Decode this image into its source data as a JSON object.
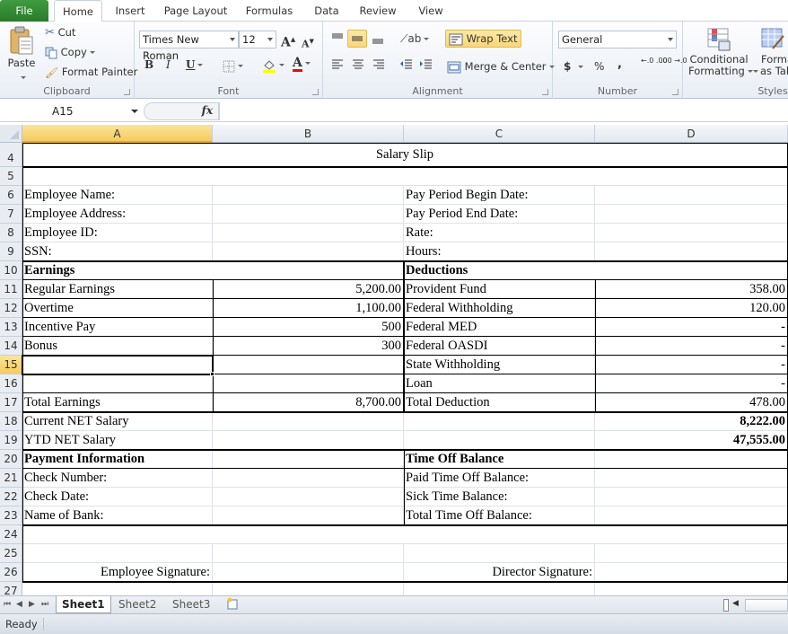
{
  "ribbon_tabs": [
    {
      "label": "File"
    },
    {
      "label": "Home"
    },
    {
      "label": "Insert"
    },
    {
      "label": "Page Layout"
    },
    {
      "label": "Formulas"
    },
    {
      "label": "Data"
    },
    {
      "label": "Review"
    },
    {
      "label": "View"
    }
  ],
  "active_tab": "Home",
  "clipboard": {
    "paste": "Paste",
    "cut": "Cut",
    "copy": "Copy",
    "format_painter": "Format Painter",
    "group_label": "Clipboard"
  },
  "font": {
    "name": "Times New Roman",
    "size": "12",
    "group_label": "Font",
    "bold": "B",
    "italic": "I",
    "underline": "U",
    "grow": "A",
    "shrink": "A",
    "font_color": "A",
    "fill_color_hex": "#ffff00",
    "font_color_hex": "#ff0000"
  },
  "alignment": {
    "wrap_text": "Wrap Text",
    "merge_center": "Merge & Center",
    "group_label": "Alignment"
  },
  "number": {
    "format": "General",
    "currency": "$",
    "percent": "%",
    "comma": ",",
    "inc_decimal": "←.0 .00",
    "dec_decimal": ".00 →.0",
    "group_label": "Number"
  },
  "styles": {
    "conditional_formatting_line1": "Conditional",
    "conditional_formatting_line2": "Formatting",
    "format_as_table_line1": "Format",
    "format_as_table_line2": "as Table",
    "group_label": "Styles"
  },
  "formula_bar": {
    "name_box": "A15",
    "fx": "fx",
    "content": ""
  },
  "columns": [
    "A",
    "B",
    "C",
    "D"
  ],
  "selected_column": "A",
  "selected_row": "15",
  "rows": [
    {
      "num": "4"
    },
    {
      "num": "5"
    },
    {
      "num": "6"
    },
    {
      "num": "7"
    },
    {
      "num": "8"
    },
    {
      "num": "9"
    },
    {
      "num": "10"
    },
    {
      "num": "11"
    },
    {
      "num": "12"
    },
    {
      "num": "13"
    },
    {
      "num": "14"
    },
    {
      "num": "15"
    },
    {
      "num": "16"
    },
    {
      "num": "17"
    },
    {
      "num": "18"
    },
    {
      "num": "19"
    },
    {
      "num": "20"
    },
    {
      "num": "21"
    },
    {
      "num": "22"
    },
    {
      "num": "23"
    },
    {
      "num": "24"
    },
    {
      "num": "25"
    },
    {
      "num": "26"
    },
    {
      "num": "27"
    }
  ],
  "sheet": {
    "title": "Salary Slip",
    "employee_info": [
      {
        "label": "Employee Name:",
        "right_label": "Pay Period Begin Date:"
      },
      {
        "label": "Employee Address:",
        "right_label": "Pay Period End Date:"
      },
      {
        "label": "Employee ID:",
        "right_label": "Rate:"
      },
      {
        "label": "SSN:",
        "right_label": "Hours:"
      }
    ],
    "earnings_header": "Earnings",
    "deductions_header": "Deductions",
    "earnings": [
      {
        "label": "Regular Earnings",
        "value": "5,200.00"
      },
      {
        "label": "Overtime",
        "value": "1,100.00"
      },
      {
        "label": "Incentive Pay",
        "value": "500"
      },
      {
        "label": "Bonus",
        "value": "300"
      },
      {
        "label": "",
        "value": ""
      },
      {
        "label": "",
        "value": ""
      }
    ],
    "deductions": [
      {
        "label": "Provident Fund",
        "value": "358.00"
      },
      {
        "label": "Federal Withholding",
        "value": "120.00"
      },
      {
        "label": "Federal MED",
        "value": "-"
      },
      {
        "label": "Federal OASDI",
        "value": "-"
      },
      {
        "label": "State Withholding",
        "value": "-"
      },
      {
        "label": "Loan",
        "value": "-"
      }
    ],
    "total_earnings_label": "Total Earnings",
    "total_earnings_value": "8,700.00",
    "total_deduction_label": "Total Deduction",
    "total_deduction_value": "478.00",
    "current_net_label": "Current NET Salary",
    "current_net_value": "8,222.00",
    "ytd_net_label": "YTD NET Salary",
    "ytd_net_value": "47,555.00",
    "payment_header": "Payment Information",
    "timeoff_header": "Time Off Balance",
    "payment_info": [
      {
        "label": "Check  Number:",
        "right_label": "Paid Time Off Balance:"
      },
      {
        "label": "Check Date:",
        "right_label": "Sick Time Balance:"
      },
      {
        "label": "Name of Bank:",
        "right_label": "Total Time Off Balance:"
      }
    ],
    "employee_signature": "Employee Signature:",
    "director_signature": "Director  Signature:"
  },
  "sheet_tabs": [
    {
      "label": "Sheet1"
    },
    {
      "label": "Sheet2"
    },
    {
      "label": "Sheet3"
    }
  ],
  "active_sheet": "Sheet1",
  "status": "Ready"
}
